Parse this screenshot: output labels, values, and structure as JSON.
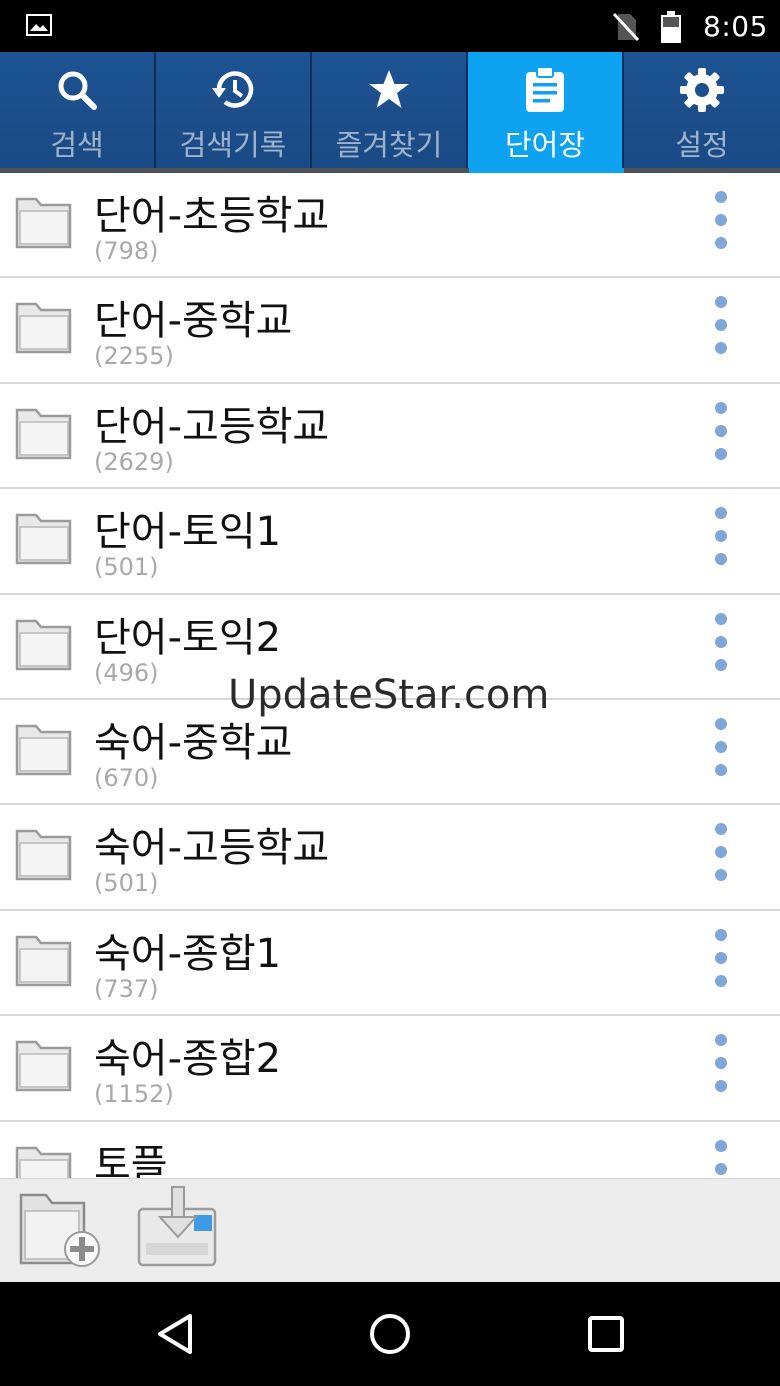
{
  "status_bar": {
    "time": "8:05",
    "icons": [
      "gallery-icon",
      "no-sim-icon",
      "battery-icon"
    ]
  },
  "tabs": [
    {
      "label": "검색",
      "icon": "search-icon",
      "active": false
    },
    {
      "label": "검색기록",
      "icon": "history-icon",
      "active": false
    },
    {
      "label": "즐겨찾기",
      "icon": "star-icon",
      "active": false
    },
    {
      "label": "단어장",
      "icon": "clipboard-icon",
      "active": true
    },
    {
      "label": "설정",
      "icon": "gear-icon",
      "active": false
    }
  ],
  "folders": [
    {
      "name": "단어-초등학교",
      "count": "(798)"
    },
    {
      "name": "단어-중학교",
      "count": "(2255)"
    },
    {
      "name": "단어-고등학교",
      "count": "(2629)"
    },
    {
      "name": "단어-토익1",
      "count": "(501)"
    },
    {
      "name": "단어-토익2",
      "count": "(496)"
    },
    {
      "name": "숙어-중학교",
      "count": "(670)"
    },
    {
      "name": "숙어-고등학교",
      "count": "(501)"
    },
    {
      "name": "숙어-종합1",
      "count": "(737)"
    },
    {
      "name": "숙어-종합2",
      "count": "(1152)"
    },
    {
      "name": "토플",
      "count": ""
    }
  ],
  "watermark": "UpdateStar.com",
  "toolbar": {
    "buttons": [
      "add-folder-icon",
      "import-icon"
    ]
  },
  "navbar": {
    "buttons": [
      "back-icon",
      "home-icon",
      "recents-icon"
    ]
  },
  "colors": {
    "tab_bg": "#1b4b86",
    "tab_active": "#0ea3f1",
    "dots": "#7fa6d9"
  }
}
